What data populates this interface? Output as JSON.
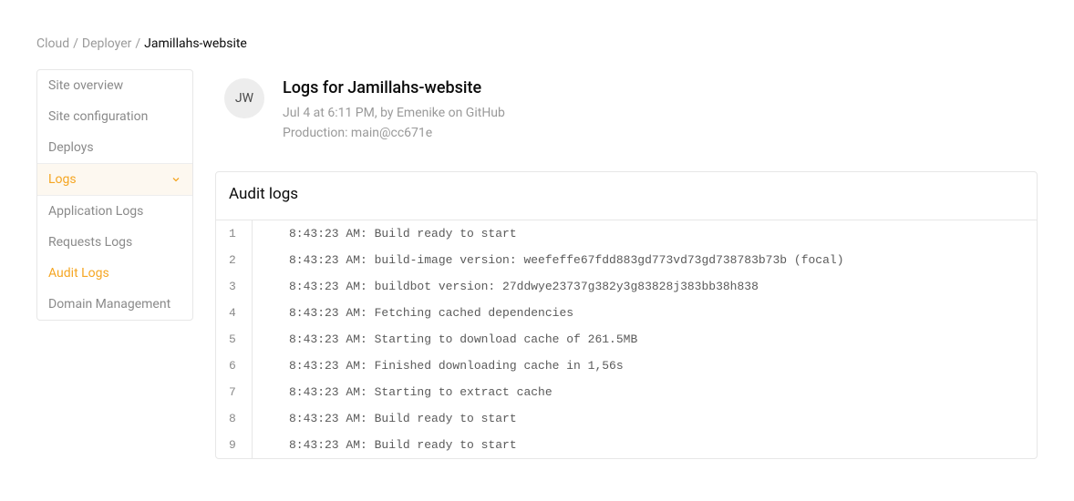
{
  "breadcrumb": {
    "items": [
      "Cloud",
      "Deployer"
    ],
    "current": "Jamillahs-website"
  },
  "sidebar": {
    "items": [
      {
        "label": "Site overview"
      },
      {
        "label": "Site configuration"
      },
      {
        "label": "Deploys"
      },
      {
        "label": "Logs",
        "active": true,
        "expandable": true
      },
      {
        "label": "Application Logs",
        "sub": true
      },
      {
        "label": "Requests Logs",
        "sub": true
      },
      {
        "label": "Audit Logs",
        "sub": true,
        "activeSub": true
      },
      {
        "label": "Domain Management"
      }
    ]
  },
  "header": {
    "avatarInitials": "JW",
    "title": "Logs for Jamillahs-website",
    "meta1": "Jul 4 at 6:11 PM, by Emenike on GitHub",
    "meta2": "Production: main@cc671e"
  },
  "logs": {
    "sectionTitle": "Audit logs",
    "entries": [
      {
        "n": "1",
        "t": "8:43:23 AM: Build ready to start"
      },
      {
        "n": "2",
        "t": "8:43:23 AM: build-image version: weefeffe67fdd883gd773vd73gd738783b73b (focal)"
      },
      {
        "n": "3",
        "t": "8:43:23 AM: buildbot version: 27ddwye23737g382y3g83828j383bb38h838"
      },
      {
        "n": "4",
        "t": "8:43:23 AM: Fetching cached dependencies"
      },
      {
        "n": "5",
        "t": "8:43:23 AM: Starting to download cache of 261.5MB"
      },
      {
        "n": "6",
        "t": "8:43:23 AM: Finished downloading cache in 1,56s"
      },
      {
        "n": "7",
        "t": "8:43:23 AM: Starting to extract cache"
      },
      {
        "n": "8",
        "t": "8:43:23 AM: Build ready to start"
      },
      {
        "n": "9",
        "t": "8:43:23 AM: Build ready to start"
      }
    ]
  }
}
